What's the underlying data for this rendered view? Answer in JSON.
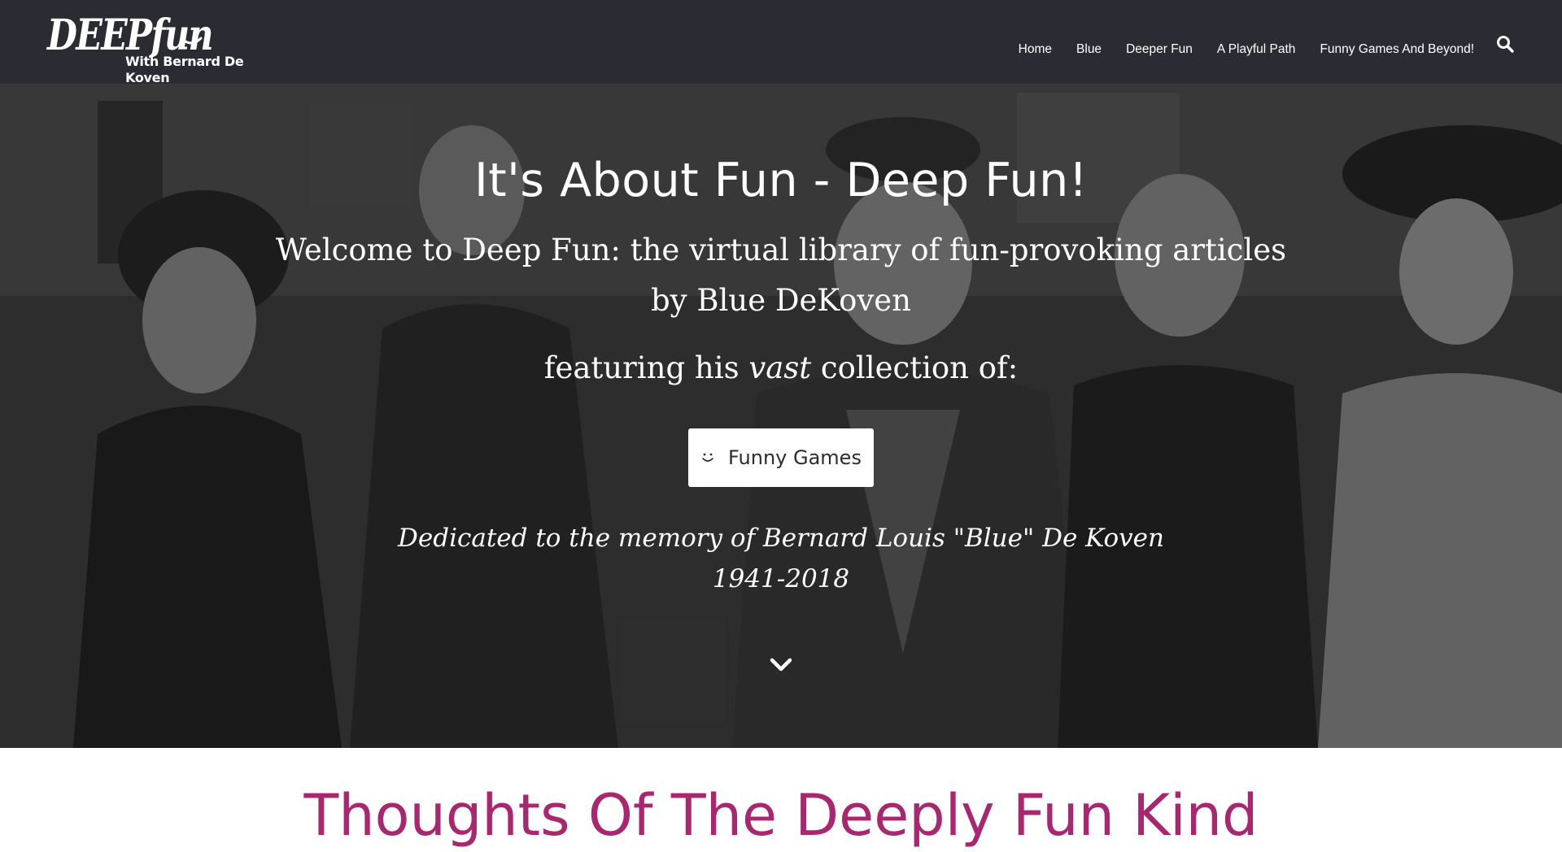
{
  "logo": {
    "main": "DEEPfun",
    "sub": "With Bernard De Koven",
    "icon": "smile-icon"
  },
  "nav": {
    "items": [
      {
        "label": "Home"
      },
      {
        "label": "Blue"
      },
      {
        "label": "Deeper Fun"
      },
      {
        "label": "A Playful Path"
      },
      {
        "label": "Funny Games And Beyond!"
      }
    ],
    "search_icon": "search-icon"
  },
  "hero": {
    "title": "It's About Fun - Deep Fun!",
    "welcome": "Welcome to Deep Fun: the virtual library of fun-provoking articles",
    "byline": "by Blue DeKoven",
    "featuring_before": "featuring his ",
    "featuring_em": "vast",
    "featuring_after": " collection of:",
    "cta_label": "Funny Games",
    "cta_icon": "smile-icon",
    "dedication": "Dedicated to the memory of Bernard Louis \"Blue\" De Koven",
    "years": "1941-2018",
    "scroll_icon": "chevron-down-icon"
  },
  "section": {
    "title": "Thoughts Of The Deeply Fun Kind"
  },
  "colors": {
    "header_bg": "#2b2c33",
    "accent": "#a8276f",
    "hero_text": "#ffffff"
  }
}
